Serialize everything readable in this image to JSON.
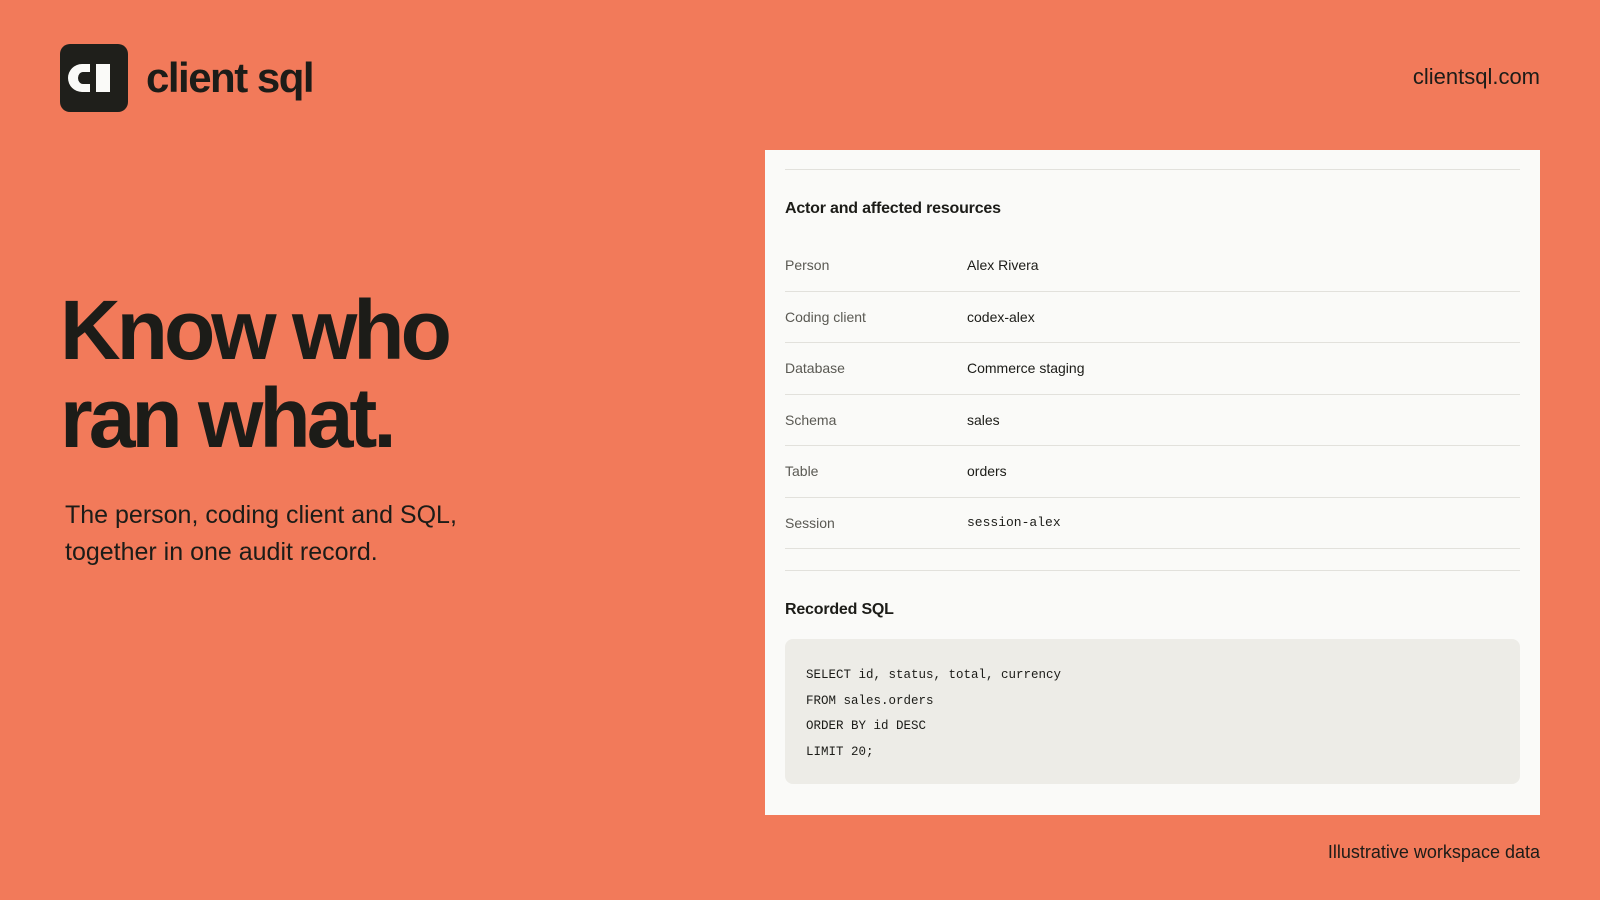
{
  "brand": {
    "logo_icon": "cl-monogram-icon",
    "name": "client sql",
    "site_link": "clientsql.com"
  },
  "hero": {
    "title_lines": [
      "Know who",
      "ran what."
    ],
    "subtitle_lines": [
      "The person, coding client and SQL,",
      "together in one audit record."
    ]
  },
  "card": {
    "actor_section_title": "Actor and affected resources",
    "fields": [
      {
        "key": "Person",
        "value": "Alex Rivera"
      },
      {
        "key": "Coding client",
        "value": "codex-alex"
      },
      {
        "key": "Database",
        "value": "Commerce staging"
      },
      {
        "key": "Schema",
        "value": "sales"
      },
      {
        "key": "Table",
        "value": "orders"
      },
      {
        "key": "Session",
        "value": "session-alex"
      }
    ],
    "sql_section_title": "Recorded SQL",
    "sql_lines": [
      "SELECT id, status, total, currency",
      "FROM sales.orders",
      "ORDER BY id DESC",
      "LIMIT 20;"
    ]
  },
  "footer": {
    "note": "Illustrative workspace data"
  },
  "colors": {
    "background": "#f27a5a",
    "ink": "#1c1c18",
    "card": "#fafaf8",
    "code_bg": "#edece7"
  }
}
